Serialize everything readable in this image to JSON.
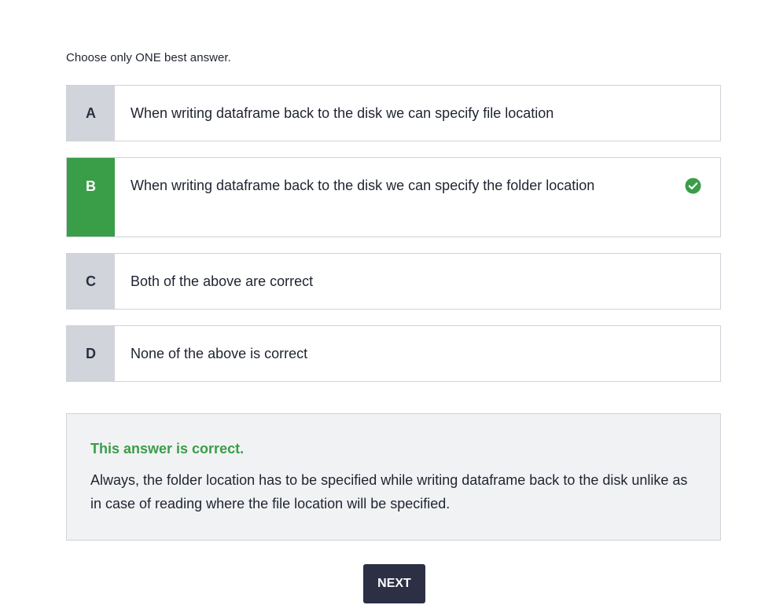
{
  "instruction": "Choose only ONE best answer.",
  "options": [
    {
      "letter": "A",
      "text": "When writing dataframe back to the disk we can specify file location",
      "selected": false
    },
    {
      "letter": "B",
      "text": "When writing dataframe back to the disk we can specify the folder location",
      "selected": true
    },
    {
      "letter": "C",
      "text": "Both of the above are correct",
      "selected": false
    },
    {
      "letter": "D",
      "text": "None of the above is correct",
      "selected": false
    }
  ],
  "feedback": {
    "title": "This answer is correct.",
    "body": "Always, the folder location has to be specified while writing dataframe back to the disk unlike as in case of reading where the file location will be specified."
  },
  "next_label": "NEXT",
  "icons": {
    "correct": "check-circle-icon"
  },
  "colors": {
    "correct_green": "#3a9d48",
    "letter_gray": "#d1d4db",
    "button_dark": "#2d2f45",
    "feedback_bg": "#f1f2f4"
  }
}
